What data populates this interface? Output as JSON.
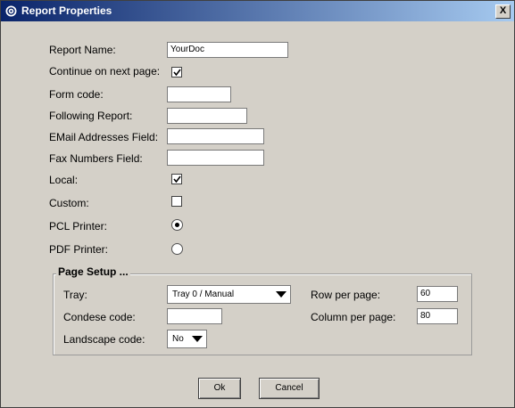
{
  "window": {
    "title": "Report Properties",
    "close_label": "X"
  },
  "form": {
    "report_name": {
      "label": "Report Name:",
      "value": "YourDoc"
    },
    "continue_next_page": {
      "label": "Continue on next page:",
      "checked": true
    },
    "form_code": {
      "label": "Form code:",
      "value": ""
    },
    "following_report": {
      "label": "Following Report:",
      "value": ""
    },
    "email_field": {
      "label": "EMail Addresses Field:",
      "value": ""
    },
    "fax_field": {
      "label": "Fax Numbers Field:",
      "value": ""
    },
    "local": {
      "label": "Local:",
      "checked": true
    },
    "custom": {
      "label": "Custom:",
      "checked": false
    },
    "pcl_printer": {
      "label": "PCL Printer:",
      "selected": true
    },
    "pdf_printer": {
      "label": "PDF Printer:",
      "selected": false
    }
  },
  "page_setup": {
    "legend": "Page Setup ...",
    "tray": {
      "label": "Tray:",
      "value": "Tray 0 / Manual"
    },
    "condese_code": {
      "label": "Condese code:",
      "value": ""
    },
    "landscape_code": {
      "label": "Landscape code:",
      "value": "No"
    },
    "row_per_page": {
      "label": "Row per page:",
      "value": "60"
    },
    "column_per_page": {
      "label": "Column per page:",
      "value": "80"
    }
  },
  "buttons": {
    "ok": "Ok",
    "cancel": "Cancel"
  }
}
